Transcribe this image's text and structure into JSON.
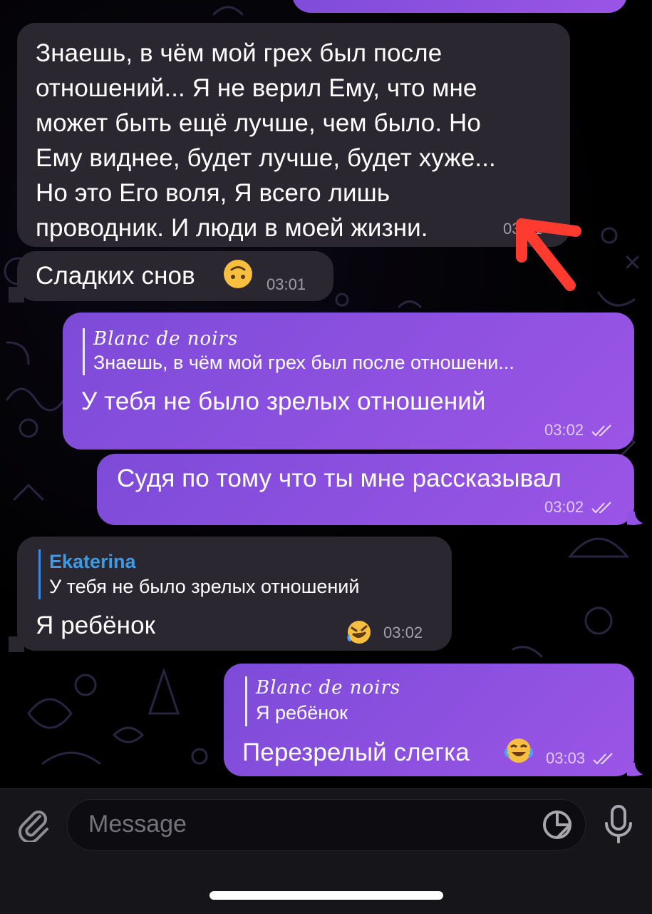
{
  "messages": {
    "m1": {
      "lines": [
        "Знаешь, в чём мой грех был после",
        "отношений... Я не верил Ему, что мне",
        "может быть ещё лучше, чем было. Но",
        "Ему виднее, будет лучше, будет хуже...",
        "Но это Его воля, Я всего лишь",
        "проводник. И люди в моей жизни."
      ],
      "time": "03:01"
    },
    "m2": {
      "text": "Сладких снов",
      "time": "03:01",
      "emoji": "upside-down-face"
    },
    "m3": {
      "reply_name": "Blanc de noirs",
      "reply_text": "Знаешь, в чём мой грех был после отношени...",
      "text": "У тебя не было зрелых отношений",
      "time": "03:02"
    },
    "m4": {
      "text": "Судя по тому что ты мне рассказывал",
      "time": "03:02"
    },
    "m5": {
      "reply_name": "Ekaterina",
      "reply_text": "У тебя не было зрелых отношений",
      "text": "Я ребёнок",
      "time": "03:02",
      "reaction": "rolling-on-floor-laughing"
    },
    "m6": {
      "reply_name": "Blanc de noirs",
      "reply_text": "Я ребёнок",
      "text": "Перезрелый слегка",
      "time": "03:03",
      "emoji": "face-with-tears-of-joy"
    }
  },
  "composer": {
    "placeholder": "Message"
  },
  "colors": {
    "incoming_bubble": "#2a2730",
    "outgoing_bubble": "#8a4fe0",
    "annotation_arrow": "#ff3b30",
    "reply_name_blue": "#3d9be6"
  },
  "icons": [
    "attach-icon",
    "sticker-icon",
    "microphone-icon",
    "double-check-icon",
    "annotation-arrow"
  ]
}
